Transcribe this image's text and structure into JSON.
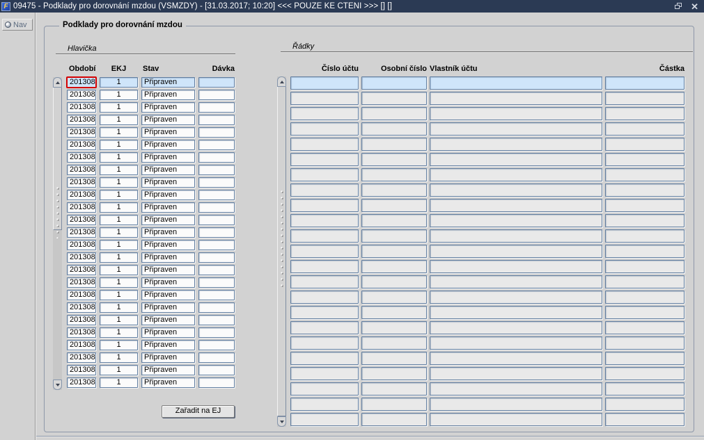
{
  "window": {
    "title": "09475 - Podklady pro dorovnání mzdou (VSMZDY) - [31.03.2017; 10:20] <<< POUZE KE ČTENÍ >>>  [] []",
    "icon_letter": "F"
  },
  "sidebar": {
    "nav_label": "Nav"
  },
  "main": {
    "group_title": "Podklady pro dorovnání mzdou",
    "hlavicka": {
      "title": "Hlavička",
      "columns": [
        "Období",
        "EKJ",
        "Stav",
        "Dávka"
      ],
      "action_button": "Zařadit na EJ",
      "rows": [
        {
          "obdobi": "201308",
          "ekj": "1",
          "stav": "Připraven",
          "davka": ""
        },
        {
          "obdobi": "201308",
          "ekj": "1",
          "stav": "Připraven",
          "davka": ""
        },
        {
          "obdobi": "201308",
          "ekj": "1",
          "stav": "Připraven",
          "davka": ""
        },
        {
          "obdobi": "201308",
          "ekj": "1",
          "stav": "Připraven",
          "davka": ""
        },
        {
          "obdobi": "201308",
          "ekj": "1",
          "stav": "Připraven",
          "davka": ""
        },
        {
          "obdobi": "201308",
          "ekj": "1",
          "stav": "Připraven",
          "davka": ""
        },
        {
          "obdobi": "201308",
          "ekj": "1",
          "stav": "Připraven",
          "davka": ""
        },
        {
          "obdobi": "201308",
          "ekj": "1",
          "stav": "Připraven",
          "davka": ""
        },
        {
          "obdobi": "201308",
          "ekj": "1",
          "stav": "Připraven",
          "davka": ""
        },
        {
          "obdobi": "201308",
          "ekj": "1",
          "stav": "Připraven",
          "davka": ""
        },
        {
          "obdobi": "201308",
          "ekj": "1",
          "stav": "Připraven",
          "davka": ""
        },
        {
          "obdobi": "201308",
          "ekj": "1",
          "stav": "Připraven",
          "davka": ""
        },
        {
          "obdobi": "201308",
          "ekj": "1",
          "stav": "Připraven",
          "davka": ""
        },
        {
          "obdobi": "201308",
          "ekj": "1",
          "stav": "Připraven",
          "davka": ""
        },
        {
          "obdobi": "201308",
          "ekj": "1",
          "stav": "Připraven",
          "davka": ""
        },
        {
          "obdobi": "201308",
          "ekj": "1",
          "stav": "Připraven",
          "davka": ""
        },
        {
          "obdobi": "201308",
          "ekj": "1",
          "stav": "Připraven",
          "davka": ""
        },
        {
          "obdobi": "201308",
          "ekj": "1",
          "stav": "Připraven",
          "davka": ""
        },
        {
          "obdobi": "201308",
          "ekj": "1",
          "stav": "Připraven",
          "davka": ""
        },
        {
          "obdobi": "201308",
          "ekj": "1",
          "stav": "Připraven",
          "davka": ""
        },
        {
          "obdobi": "201308",
          "ekj": "1",
          "stav": "Připraven",
          "davka": ""
        },
        {
          "obdobi": "201308",
          "ekj": "1",
          "stav": "Připraven",
          "davka": ""
        },
        {
          "obdobi": "201308",
          "ekj": "1",
          "stav": "Připraven",
          "davka": ""
        },
        {
          "obdobi": "201308",
          "ekj": "1",
          "stav": "Připraven",
          "davka": ""
        },
        {
          "obdobi": "201308",
          "ekj": "1",
          "stav": "Připraven",
          "davka": ""
        }
      ]
    },
    "radky": {
      "title": "Řádky",
      "columns": [
        "Číslo účtu",
        "Osobní číslo",
        "Vlastník účtu",
        "Částka"
      ],
      "rows": [
        {
          "cislo": "",
          "osobni": "",
          "vlastnik": "",
          "castka": ""
        },
        {
          "cislo": "",
          "osobni": "",
          "vlastnik": "",
          "castka": ""
        },
        {
          "cislo": "",
          "osobni": "",
          "vlastnik": "",
          "castka": ""
        },
        {
          "cislo": "",
          "osobni": "",
          "vlastnik": "",
          "castka": ""
        },
        {
          "cislo": "",
          "osobni": "",
          "vlastnik": "",
          "castka": ""
        },
        {
          "cislo": "",
          "osobni": "",
          "vlastnik": "",
          "castka": ""
        },
        {
          "cislo": "",
          "osobni": "",
          "vlastnik": "",
          "castka": ""
        },
        {
          "cislo": "",
          "osobni": "",
          "vlastnik": "",
          "castka": ""
        },
        {
          "cislo": "",
          "osobni": "",
          "vlastnik": "",
          "castka": ""
        },
        {
          "cislo": "",
          "osobni": "",
          "vlastnik": "",
          "castka": ""
        },
        {
          "cislo": "",
          "osobni": "",
          "vlastnik": "",
          "castka": ""
        },
        {
          "cislo": "",
          "osobni": "",
          "vlastnik": "",
          "castka": ""
        },
        {
          "cislo": "",
          "osobni": "",
          "vlastnik": "",
          "castka": ""
        },
        {
          "cislo": "",
          "osobni": "",
          "vlastnik": "",
          "castka": ""
        },
        {
          "cislo": "",
          "osobni": "",
          "vlastnik": "",
          "castka": ""
        },
        {
          "cislo": "",
          "osobni": "",
          "vlastnik": "",
          "castka": ""
        },
        {
          "cislo": "",
          "osobni": "",
          "vlastnik": "",
          "castka": ""
        },
        {
          "cislo": "",
          "osobni": "",
          "vlastnik": "",
          "castka": ""
        },
        {
          "cislo": "",
          "osobni": "",
          "vlastnik": "",
          "castka": ""
        },
        {
          "cislo": "",
          "osobni": "",
          "vlastnik": "",
          "castka": ""
        },
        {
          "cislo": "",
          "osobni": "",
          "vlastnik": "",
          "castka": ""
        },
        {
          "cislo": "",
          "osobni": "",
          "vlastnik": "",
          "castka": ""
        },
        {
          "cislo": "",
          "osobni": "",
          "vlastnik": "",
          "castka": ""
        }
      ]
    }
  },
  "colors": {
    "titlebar_bg": "#2b3a54",
    "selected_row_bg": "#cfe5fa",
    "field_border": "#5f7c9f",
    "current_record_border": "#d40000"
  }
}
